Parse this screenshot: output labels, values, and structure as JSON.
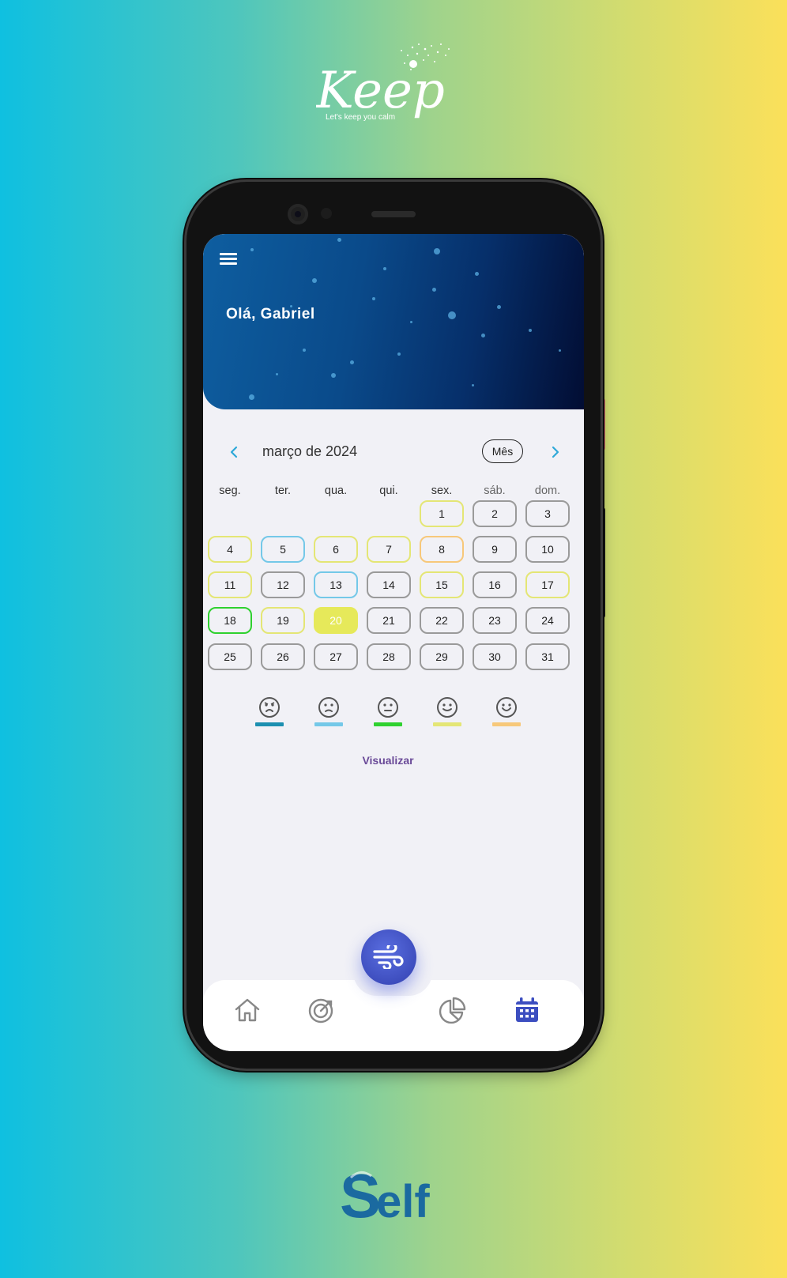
{
  "brand": {
    "top_logo_text": "Keep",
    "top_logo_tagline": "Let's keep you calm",
    "bottom_logo_text": "Self"
  },
  "header": {
    "greeting": "Olá, Gabriel"
  },
  "calendar": {
    "month_title": "março de 2024",
    "view_label": "Mês",
    "weekdays": [
      "seg.",
      "ter.",
      "qua.",
      "qui.",
      "sex.",
      "sáb.",
      "dom."
    ],
    "selected_day": "20",
    "days": [
      {
        "label": "1",
        "mood": "yellow"
      },
      {
        "label": "2",
        "mood": "none"
      },
      {
        "label": "3",
        "mood": "none"
      },
      {
        "label": "4",
        "mood": "yellow"
      },
      {
        "label": "5",
        "mood": "light-blue"
      },
      {
        "label": "6",
        "mood": "yellow"
      },
      {
        "label": "7",
        "mood": "yellow"
      },
      {
        "label": "8",
        "mood": "orange"
      },
      {
        "label": "9",
        "mood": "none"
      },
      {
        "label": "10",
        "mood": "none"
      },
      {
        "label": "11",
        "mood": "yellow"
      },
      {
        "label": "12",
        "mood": "none"
      },
      {
        "label": "13",
        "mood": "light-blue"
      },
      {
        "label": "14",
        "mood": "none"
      },
      {
        "label": "15",
        "mood": "yellow"
      },
      {
        "label": "16",
        "mood": "none"
      },
      {
        "label": "17",
        "mood": "yellow"
      },
      {
        "label": "18",
        "mood": "green"
      },
      {
        "label": "19",
        "mood": "yellow"
      },
      {
        "label": "20",
        "mood": "selected"
      },
      {
        "label": "21",
        "mood": "none"
      },
      {
        "label": "22",
        "mood": "none"
      },
      {
        "label": "23",
        "mood": "none"
      },
      {
        "label": "24",
        "mood": "none"
      },
      {
        "label": "25",
        "mood": "none"
      },
      {
        "label": "26",
        "mood": "none"
      },
      {
        "label": "27",
        "mood": "none"
      },
      {
        "label": "28",
        "mood": "none"
      },
      {
        "label": "29",
        "mood": "none"
      },
      {
        "label": "30",
        "mood": "none"
      },
      {
        "label": "31",
        "mood": "none"
      }
    ]
  },
  "moods": [
    {
      "icon": "very-sad-face-icon",
      "color": "#1c8fb0"
    },
    {
      "icon": "sad-face-icon",
      "color": "#74c8e8"
    },
    {
      "icon": "neutral-face-icon",
      "color": "#2fd12f"
    },
    {
      "icon": "happy-face-icon",
      "color": "#e4e675"
    },
    {
      "icon": "very-happy-face-icon",
      "color": "#f7c87a"
    }
  ],
  "actions": {
    "visualize_label": "Visualizar"
  },
  "navigation": {
    "items": [
      "home-icon",
      "goals-target-icon",
      "breathing-wind-icon",
      "reports-pie-chart-icon",
      "calendar-icon"
    ],
    "active": "calendar-icon",
    "active_color": "#3c4ec0",
    "inactive_color": "#888888"
  }
}
